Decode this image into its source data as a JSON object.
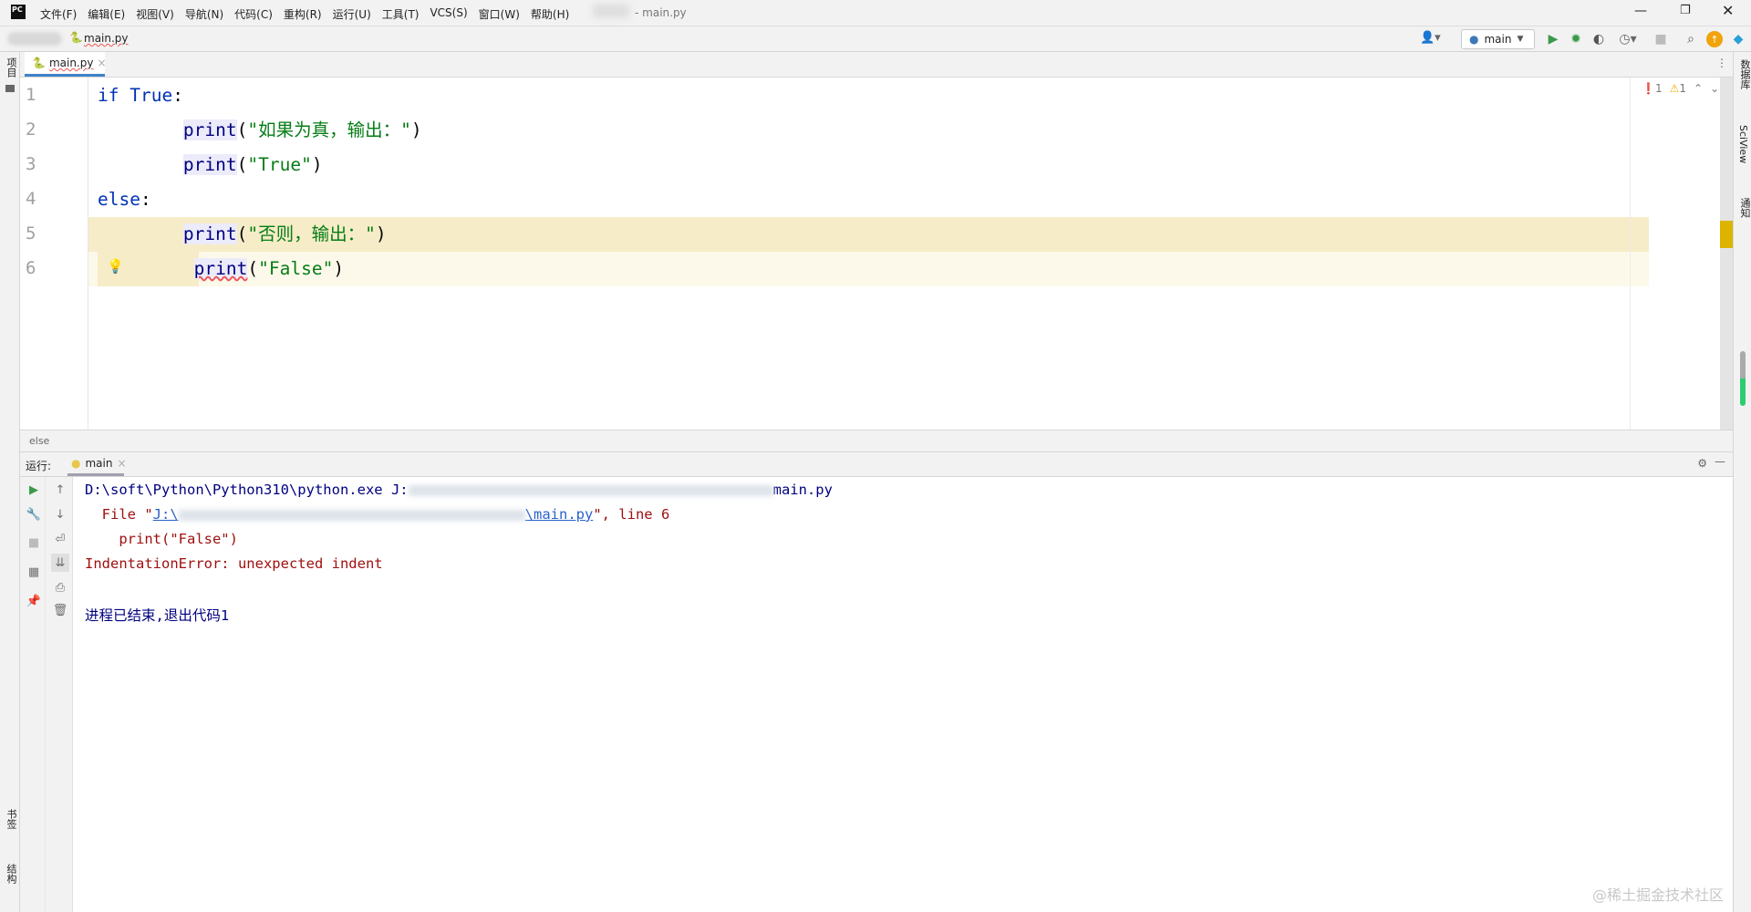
{
  "app": {
    "logo": "PC",
    "title": "- main.py"
  },
  "menu": [
    "文件(F)",
    "编辑(E)",
    "视图(V)",
    "导航(N)",
    "代码(C)",
    "重构(R)",
    "运行(U)",
    "工具(T)",
    "VCS(S)",
    "窗口(W)",
    "帮助(H)"
  ],
  "nav": {
    "file": "main.py",
    "run_config": "main"
  },
  "editor": {
    "tab": "main.py",
    "errors": "1",
    "warnings": "1",
    "lines": [
      {
        "n": "1",
        "parts": [
          [
            "kw",
            "if "
          ],
          [
            "kw",
            "True"
          ],
          [
            "pn",
            ":"
          ]
        ]
      },
      {
        "n": "2",
        "parts": [
          [
            "pn",
            "        "
          ],
          [
            "fn",
            "print"
          ],
          [
            "pn",
            "("
          ],
          [
            "str",
            "\"如果为真，输出：\""
          ],
          [
            "pn",
            ")"
          ]
        ]
      },
      {
        "n": "3",
        "parts": [
          [
            "pn",
            "        "
          ],
          [
            "fn",
            "print"
          ],
          [
            "pn",
            "("
          ],
          [
            "str",
            "\"True\""
          ],
          [
            "pn",
            ")"
          ]
        ]
      },
      {
        "n": "4",
        "parts": [
          [
            "kw",
            "else"
          ],
          [
            "pn",
            ":"
          ]
        ]
      },
      {
        "n": "5",
        "parts": [
          [
            "pn",
            "        "
          ],
          [
            "fn",
            "print"
          ],
          [
            "pn",
            "("
          ],
          [
            "str",
            "\"否则，输出：\""
          ],
          [
            "pn",
            ")"
          ]
        ]
      },
      {
        "n": "6",
        "parts": [
          [
            "pn",
            "         "
          ],
          [
            "fn",
            "print"
          ],
          [
            "pn",
            "("
          ],
          [
            "str",
            "\"False\""
          ],
          [
            "pn",
            ")"
          ]
        ]
      }
    ]
  },
  "breadcrumb": "else",
  "run": {
    "label": "运行:",
    "tab": "main"
  },
  "console": {
    "cmd_prefix": "D:\\soft\\Python\\Python310\\python.exe J:",
    "cmd_suffix": "main.py",
    "file_prefix": "  File \"",
    "file_link_start": "J:\\",
    "file_link_end": "\\main.py",
    "file_suffix": "\", line 6",
    "code_line": "    print(\"False\")",
    "error": "IndentationError: unexpected indent",
    "exit": "进程已结束,退出代码1"
  },
  "side": {
    "left_top": "项目",
    "left_bookmarks": "书签",
    "left_structure": "结构",
    "right_db": "数据库",
    "right_sciview": "SciView",
    "right_notify": "通知"
  },
  "watermark": "@稀土掘金技术社区"
}
